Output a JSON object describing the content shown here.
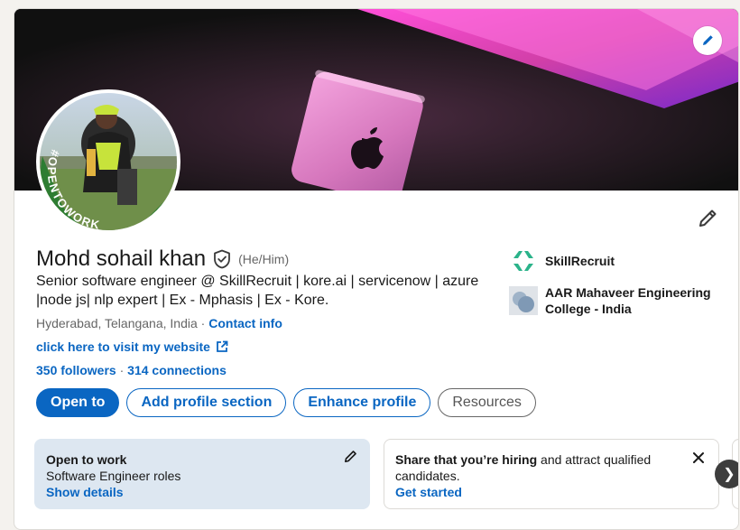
{
  "profile": {
    "name": "Mohd sohail khan",
    "pronouns": "(He/Him)",
    "headline": "Senior software engineer @ SkillRecruit | kore.ai | servicenow | azure |node js| nlp expert | Ex - Mphasis | Ex - Kore.",
    "location": "Hyderabad, Telangana, India",
    "location_separator": " · ",
    "contact_label": "Contact info",
    "website_label": "click here to visit my website",
    "followers": "350 followers",
    "stats_separator": " · ",
    "connections": "314 connections",
    "avatar_badge_text": "#OPENTOWORK"
  },
  "actions": {
    "open_to": "Open to",
    "add_section": "Add profile section",
    "enhance": "Enhance profile",
    "resources": "Resources"
  },
  "experience": [
    {
      "name": "SkillRecruit",
      "logo": "skillrecruit-logo"
    },
    {
      "name": "AAR Mahaveer Engineering College - India",
      "logo": "college-logo"
    }
  ],
  "open_to_work": {
    "title": "Open to work",
    "roles": "Software Engineer roles",
    "link": "Show details"
  },
  "hiring": {
    "bold": "Share that you’re hiring",
    "rest": " and attract qualified candidates.",
    "link": "Get started"
  },
  "carousel": {
    "next_glyph": "❯"
  },
  "colors": {
    "accent": "#0a66c2",
    "open_to_work_green": "#2e7d32",
    "open_to_work_bg": "#dde7f1"
  },
  "icons": [
    "pencil-icon",
    "verified-shield-icon",
    "external-link-icon",
    "close-icon",
    "chevron-right-icon"
  ]
}
